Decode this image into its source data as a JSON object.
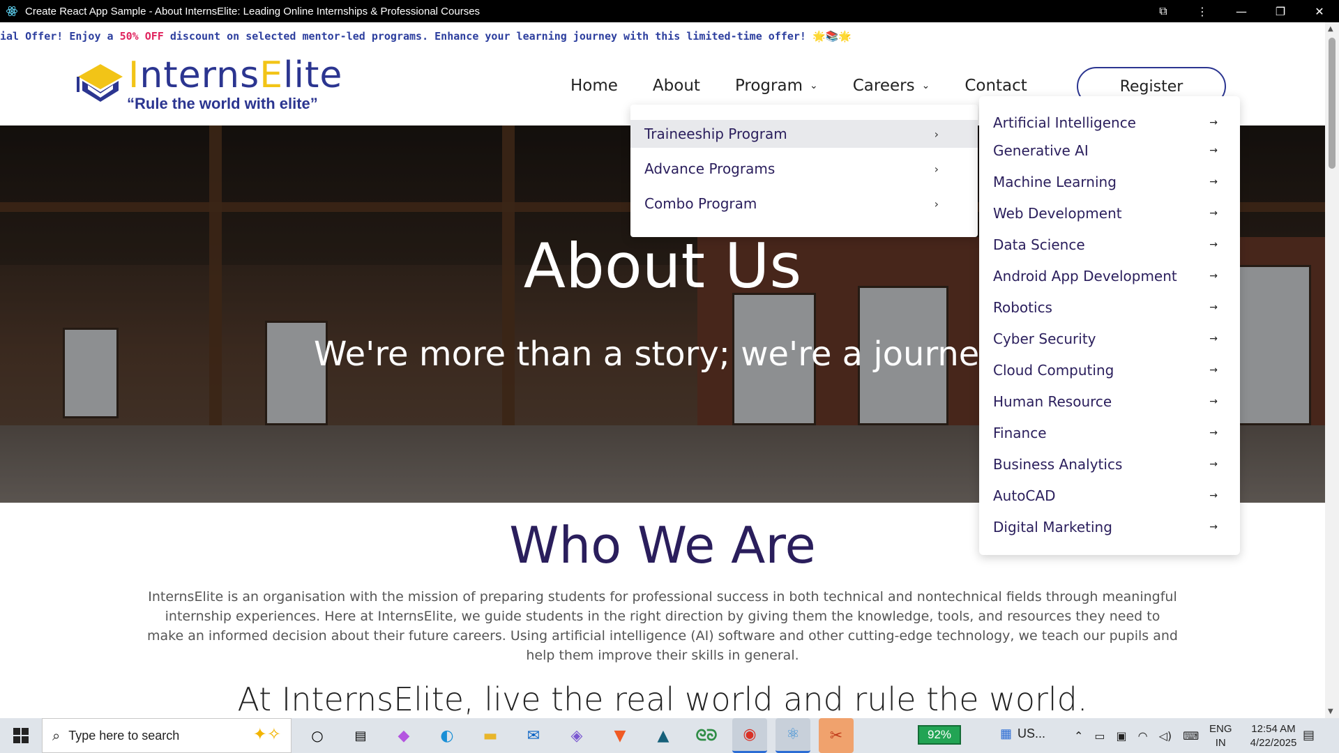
{
  "window": {
    "title": "Create React App Sample - About InternsElite: Leading Online Internships & Professional Courses"
  },
  "promo": {
    "prefix": "ial Offer! Enjoy a ",
    "highlight": "50% OFF",
    "suffix": " discount on selected mentor-led programs. Enhance your learning journey with this limited-time offer! 🌟📚🌟"
  },
  "logo": {
    "brand_part1": "I",
    "brand_part2": "nterns",
    "brand_part3": "E",
    "brand_part4": "lite",
    "tagline": "“Rule the world with elite”"
  },
  "nav": {
    "home": "Home",
    "about": "About",
    "program": "Program",
    "careers": "Careers",
    "contact": "Contact",
    "register": "Register"
  },
  "hero": {
    "title": "About Us",
    "subtitle": "We're more than a story; we're a journe"
  },
  "program_menu": [
    {
      "label": "Traineeship Program",
      "selected": true
    },
    {
      "label": "Advance Programs",
      "selected": false
    },
    {
      "label": "Combo Program",
      "selected": false
    }
  ],
  "traineeship_menu": [
    "Artificial Intelligence",
    "Generative AI",
    "Machine Learning",
    "Web Development",
    "Data Science",
    "Android App Development",
    "Robotics",
    "Cyber Security",
    "Cloud Computing",
    "Human Resource",
    "Finance",
    "Business Analytics",
    "AutoCAD",
    "Digital Marketing"
  ],
  "who": {
    "heading": "Who We Are",
    "paragraph": "InternsElite is an organisation with the mission of preparing students for professional success in both technical and nontechnical fields through meaningful internship experiences. Here at InternsElite, we guide students in the right direction by giving them the knowledge, tools, and resources they need to make an informed decision about their future careers. Using artificial intelligence (AI) software and other cutting-edge technology, we teach our pupils and help them improve their skills in general.",
    "motto": "At InternsElite, live the real world and rule the world."
  },
  "taskbar": {
    "search_placeholder": "Type here to search",
    "battery_app": "92%",
    "weather": "US...",
    "lang_line1": "ENG",
    "lang_line2": "IN",
    "time": "12:54 AM",
    "date": "4/22/2025"
  },
  "colors": {
    "brand_blue": "#2b3590",
    "brand_yellow": "#f2c417",
    "heading_purple": "#2a1e5c",
    "promo_blue": "#2c3e9e",
    "promo_pink": "#e0245e"
  }
}
